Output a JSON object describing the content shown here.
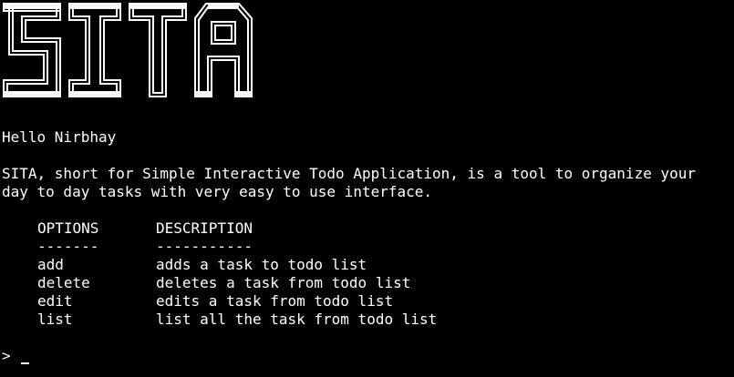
{
  "banner": {
    "text": "SITA",
    "color": "#ffffff"
  },
  "greeting": "Hello Nirbhay",
  "description": {
    "line1": "SITA, short for Simple Interactive Todo Application, is a tool to organize your",
    "line2": "day to day tasks with very easy to use interface."
  },
  "table": {
    "headers": {
      "option": "OPTIONS",
      "description": "DESCRIPTION"
    },
    "separators": {
      "option": "-------",
      "description": "-----------"
    },
    "rows": [
      {
        "option": "add",
        "description": "adds a task to todo list"
      },
      {
        "option": "delete",
        "description": "deletes a task from todo list"
      },
      {
        "option": "edit",
        "description": "edits a task from todo list"
      },
      {
        "option": "list",
        "description": "list all the task from todo list"
      }
    ]
  },
  "prompt": {
    "symbol": ">",
    "input_value": ""
  },
  "colors": {
    "background": "#000000",
    "foreground": "#ffffff"
  }
}
